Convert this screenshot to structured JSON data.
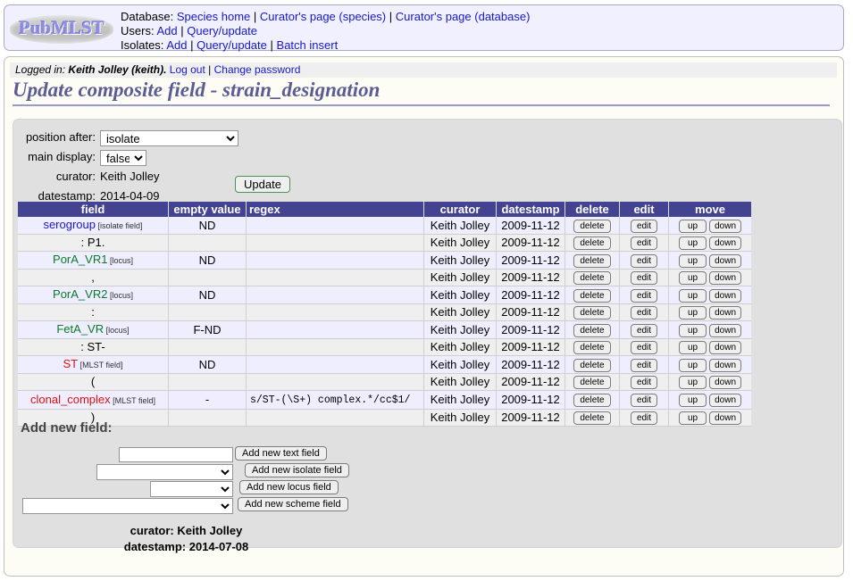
{
  "banner": {
    "logo_text": "PubMLST",
    "nav": [
      {
        "label": "Database:",
        "links": [
          "Species home",
          "Curator's page (species)",
          "Curator's page (database)"
        ]
      },
      {
        "label": "Users:",
        "links": [
          "Add",
          "Query/update"
        ]
      },
      {
        "label": "Isolates:",
        "links": [
          "Add",
          "Query/update",
          "Batch insert"
        ]
      }
    ],
    "separator": "|"
  },
  "login": {
    "prefix": "Logged in:",
    "user": "Keith Jolley (keith).",
    "logout": "Log out",
    "separator": "|",
    "change_password": "Change password"
  },
  "page_title": "Update composite field - strain_designation",
  "form": {
    "position_after_label": "position after:",
    "position_after_value": "isolate",
    "main_display_label": "main display:",
    "main_display_value": "false",
    "curator_label": "curator:",
    "curator_value": "Keith Jolley",
    "datestamp_label": "datestamp:",
    "datestamp_value": "2014-04-09",
    "update_button": "Update"
  },
  "table": {
    "headers": [
      "field",
      "empty value",
      "regex",
      "curator",
      "datestamp",
      "delete",
      "edit",
      "move"
    ],
    "buttons": {
      "delete": "delete",
      "edit": "edit",
      "up": "up",
      "down": "down"
    },
    "rows": [
      {
        "field": "serogroup",
        "field_type": "[isolate field]",
        "color": "blue",
        "empty": "ND",
        "regex": "",
        "curator": "Keith Jolley",
        "datestamp": "2009-11-12"
      },
      {
        "field": ": P1.",
        "field_type": "",
        "color": "black",
        "empty": "",
        "regex": "",
        "curator": "Keith Jolley",
        "datestamp": "2009-11-12"
      },
      {
        "field": "PorA_VR1",
        "field_type": "[locus]",
        "color": "green",
        "empty": "ND",
        "regex": "",
        "curator": "Keith Jolley",
        "datestamp": "2009-11-12"
      },
      {
        "field": ",",
        "field_type": "",
        "color": "black",
        "empty": "",
        "regex": "",
        "curator": "Keith Jolley",
        "datestamp": "2009-11-12"
      },
      {
        "field": "PorA_VR2",
        "field_type": "[locus]",
        "color": "green",
        "empty": "ND",
        "regex": "",
        "curator": "Keith Jolley",
        "datestamp": "2009-11-12"
      },
      {
        "field": ":",
        "field_type": "",
        "color": "black",
        "empty": "",
        "regex": "",
        "curator": "Keith Jolley",
        "datestamp": "2009-11-12"
      },
      {
        "field": "FetA_VR",
        "field_type": "[locus]",
        "color": "green",
        "empty": "F-ND",
        "regex": "",
        "curator": "Keith Jolley",
        "datestamp": "2009-11-12"
      },
      {
        "field": ": ST-",
        "field_type": "",
        "color": "black",
        "empty": "",
        "regex": "",
        "curator": "Keith Jolley",
        "datestamp": "2009-11-12"
      },
      {
        "field": "ST",
        "field_type": "[MLST field]",
        "color": "red",
        "empty": "ND",
        "regex": "",
        "curator": "Keith Jolley",
        "datestamp": "2009-11-12"
      },
      {
        "field": "(",
        "field_type": "",
        "color": "black",
        "empty": "",
        "regex": "",
        "curator": "Keith Jolley",
        "datestamp": "2009-11-12"
      },
      {
        "field": "clonal_complex",
        "field_type": "[MLST field]",
        "color": "red",
        "empty": "-",
        "regex": "s/ST-(\\S+) complex.*/cc$1/",
        "curator": "Keith Jolley",
        "datestamp": "2009-11-12"
      },
      {
        "field": ")",
        "field_type": "",
        "color": "black",
        "empty": "",
        "regex": "",
        "curator": "Keith Jolley",
        "datestamp": "2009-11-12"
      }
    ]
  },
  "add_new": {
    "title": "Add new field:",
    "text_input_value": "",
    "text_input_placeholder": "",
    "isolate_select_value": "",
    "locus_select_value": "",
    "scheme_select_value": "",
    "buttons": {
      "text": "Add new text field",
      "isolate": "Add new isolate field",
      "locus": "Add new locus field",
      "scheme": "Add new scheme field"
    },
    "curator_label": "curator:",
    "curator_value": "Keith Jolley",
    "datestamp_label": "datestamp:",
    "datestamp_value": "2014-07-08"
  }
}
